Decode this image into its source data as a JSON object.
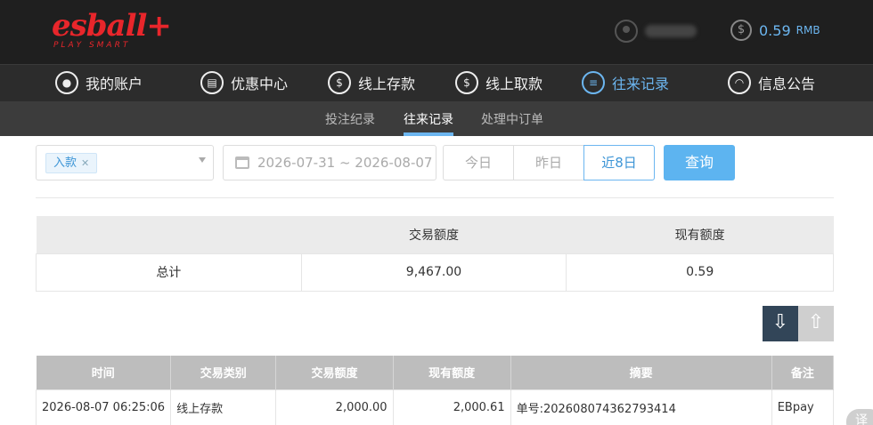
{
  "header": {
    "logo_main": "esball+",
    "logo_sub": "PLAY SMART",
    "balance_value": "0.59",
    "balance_unit": "RMB"
  },
  "main_nav": [
    {
      "label": "我的账户",
      "icon": "user-icon"
    },
    {
      "label": "优惠中心",
      "icon": "gift-icon"
    },
    {
      "label": "线上存款",
      "icon": "deposit-icon"
    },
    {
      "label": "线上取款",
      "icon": "withdraw-icon"
    },
    {
      "label": "往来记录",
      "icon": "records-icon",
      "active": true
    },
    {
      "label": "信息公告",
      "icon": "bell-icon"
    }
  ],
  "sub_nav": [
    {
      "label": "投注纪录"
    },
    {
      "label": "往来记录",
      "active": true
    },
    {
      "label": "处理中订单"
    }
  ],
  "filters": {
    "type_tag": "入款",
    "date_range": "2026-07-31 ~ 2026-08-07",
    "ranges": [
      "今日",
      "昨日",
      "近8日"
    ],
    "active_range": "近8日",
    "query_label": "查询"
  },
  "summary": {
    "headers": [
      "",
      "交易额度",
      "现有额度"
    ],
    "row": [
      "总计",
      "9,467.00",
      "0.59"
    ]
  },
  "records": {
    "headers": [
      "时间",
      "交易类别",
      "交易额度",
      "现有额度",
      "摘要",
      "备注"
    ],
    "rows": [
      [
        "2026-08-07 06:25:06",
        "线上存款",
        "2,000.00",
        "2,000.61",
        "单号:202608074362793414",
        "EBpay"
      ]
    ]
  },
  "translate_badge": "译",
  "colors": {
    "accent": "#5db4f0",
    "brand": "#e8262b",
    "header_bg": "#1f1f1f"
  }
}
